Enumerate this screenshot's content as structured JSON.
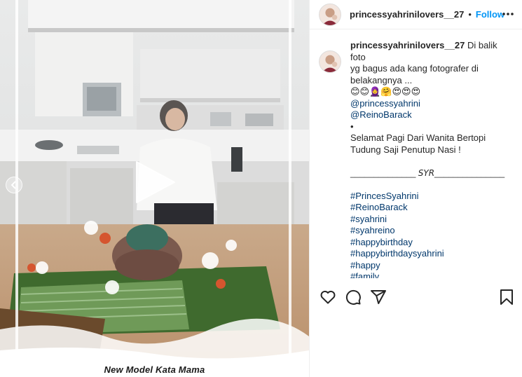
{
  "media": {
    "overlay_caption": "New Model Kata Mama"
  },
  "post": {
    "username": "princessyahrinilovers__27",
    "separator": "•",
    "follow_label": "Follow"
  },
  "caption": {
    "username": "princessyahrinilovers__27",
    "lines": [
      "Di balik foto",
      "yg bagus ada kang fotografer di",
      "belakangnya ..."
    ],
    "emojis": "😊😊🧕🤗😍😍😍",
    "mentions": [
      "@princessyahrini",
      "@ReinoBarack"
    ],
    "bullet": "•",
    "greeting": "Selamat Pagi Dari Wanita Bertopi Tudung Saji Penutup Nasi !",
    "signature": "______________ 𝘚𝘠𝘙_______________",
    "hashtags": [
      "#PrincesSyahrini",
      "#ReinoBarack",
      "#syahrini",
      "#syahreino",
      "#happybirthday",
      "#happybirthdaysyahrini",
      "#happy",
      "#family"
    ]
  },
  "colors": {
    "link_blue": "#0095f6",
    "hashtag_navy": "#00376b",
    "text": "#262626"
  },
  "icons": [
    "more-options-icon",
    "like-heart-icon",
    "comment-icon",
    "share-icon",
    "save-bookmark-icon",
    "play-icon",
    "chevron-left-icon"
  ]
}
